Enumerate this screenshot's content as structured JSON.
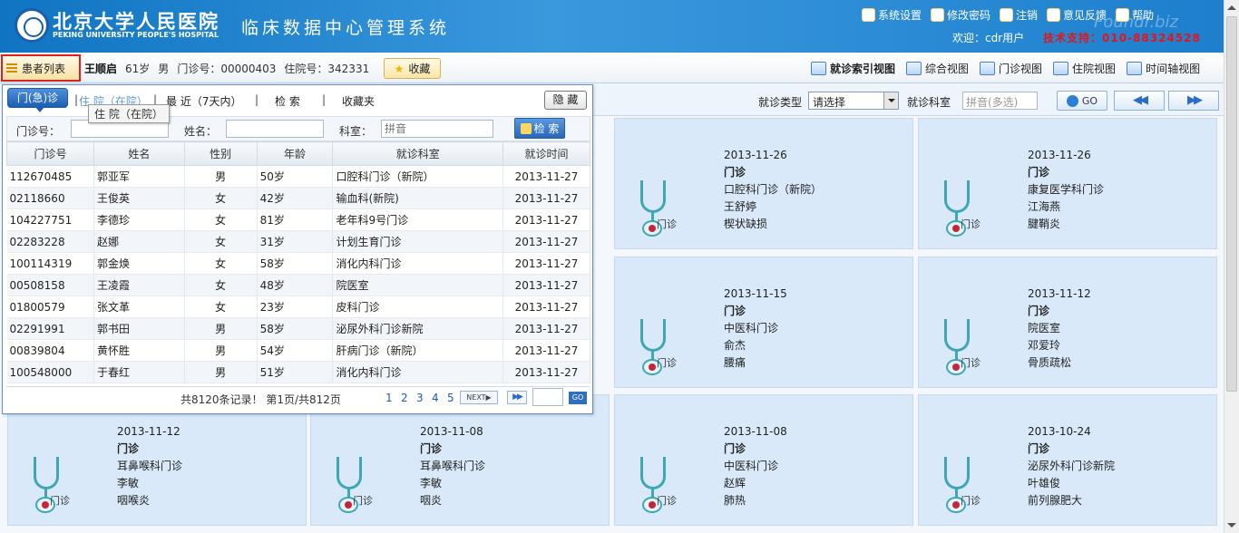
{
  "header": {
    "hospital_cn": "北京大学人民医院",
    "hospital_en": "PEKING UNIVERSITY PEOPLE'S HOSPITAL",
    "system_title": "临床数据中心管理系统",
    "watermark": "Foundr.biz",
    "nav": [
      {
        "label": "系统设置",
        "icon": "gear-icon"
      },
      {
        "label": "修改密码",
        "icon": "pencil-icon"
      },
      {
        "label": "注销",
        "icon": "clock-icon"
      },
      {
        "label": "意见反馈",
        "icon": "feedback-icon"
      },
      {
        "label": "帮助",
        "icon": "help-icon"
      }
    ],
    "welcome": "欢迎：cdr用户",
    "support": "技术支持：010-88324528"
  },
  "patient_bar": {
    "list_button": "患者列表",
    "name": "王顺启",
    "age": "61岁",
    "gender": "男",
    "outpatient_no": "门诊号：00000403",
    "inpatient_no": "住院号：342331",
    "favorite_button": "收藏",
    "views": [
      {
        "label": "就诊索引视图",
        "active": true
      },
      {
        "label": "综合视图",
        "active": false
      },
      {
        "label": "门诊视图",
        "active": false
      },
      {
        "label": "住院视图",
        "active": false
      },
      {
        "label": "时间轴视图",
        "active": false
      }
    ]
  },
  "filter": {
    "visit_type_label": "就诊类型",
    "visit_type_value": "请选择",
    "dept_label": "就诊科室",
    "dept_placeholder": "拼音(多选)",
    "go_label": "GO",
    "prev_label": "◀◀",
    "next_label": "▶▶"
  },
  "cards": [
    {
      "date": "2013-11-26",
      "type": "门诊",
      "dept": "口腔科门诊（新院）",
      "doctor": "王舒婷",
      "diagnosis": "楔状缺损"
    },
    {
      "date": "2013-11-26",
      "type": "门诊",
      "dept": "康复医学科门诊",
      "doctor": "江海燕",
      "diagnosis": "腱鞘炎"
    },
    {
      "date": "2013-11-15",
      "type": "门诊",
      "dept": "中医科门诊",
      "doctor": "俞杰",
      "diagnosis": "腰痛"
    },
    {
      "date": "2013-11-12",
      "type": "门诊",
      "dept": "院医室",
      "doctor": "邓爱玲",
      "diagnosis": "骨质疏松"
    },
    {
      "date": "2013-11-12",
      "type": "门诊",
      "dept": "耳鼻喉科门诊",
      "doctor": "李敏",
      "diagnosis": "咽喉炎"
    },
    {
      "date": "2013-11-08",
      "type": "门诊",
      "dept": "耳鼻喉科门诊",
      "doctor": "李敏",
      "diagnosis": "咽炎"
    },
    {
      "date": "2013-11-08",
      "type": "门诊",
      "dept": "中医科门诊",
      "doctor": "赵辉",
      "diagnosis": "肺热"
    },
    {
      "date": "2013-10-24",
      "type": "门诊",
      "dept": "泌尿外科门诊新院",
      "doctor": "叶雄俊",
      "diagnosis": "前列腺肥大"
    }
  ],
  "card_icon_label": "门诊",
  "popup": {
    "tabs": {
      "outpatient": "门(急)诊",
      "inpatient": "住 院（在院）",
      "recent": "最 近（7天内）",
      "search": "检 索",
      "favorites": "收藏夹",
      "separator": "|"
    },
    "hide_button": "隐 藏",
    "tooltip": "住 院（在院）",
    "search": {
      "outpatient_label": "门诊号：",
      "outpatient_value": "",
      "name_label": "姓名：",
      "name_value": "",
      "dept_label": "科室：",
      "dept_placeholder": "拼音",
      "button": "检 索"
    },
    "columns": [
      "门诊号",
      "姓名",
      "性别",
      "年龄",
      "就诊科室",
      "就诊时间"
    ],
    "rows": [
      [
        "112670485",
        "郭亚军",
        "男",
        "50岁",
        "口腔科门诊（新院）",
        "2013-11-27"
      ],
      [
        "02118660",
        "王俊英",
        "女",
        "42岁",
        "输血科(新院)",
        "2013-11-27"
      ],
      [
        "104227751",
        "李德珍",
        "女",
        "81岁",
        "老年科9号门诊",
        "2013-11-27"
      ],
      [
        "02283228",
        "赵娜",
        "女",
        "31岁",
        "计划生育门诊",
        "2013-11-27"
      ],
      [
        "100114319",
        "郭金焕",
        "女",
        "58岁",
        "消化内科门诊",
        "2013-11-27"
      ],
      [
        "00508158",
        "王凌霞",
        "女",
        "48岁",
        "院医室",
        "2013-11-27"
      ],
      [
        "01800579",
        "张文革",
        "女",
        "23岁",
        "皮科门诊",
        "2013-11-27"
      ],
      [
        "02291991",
        "郭书田",
        "男",
        "58岁",
        "泌尿外科门诊新院",
        "2013-11-27"
      ],
      [
        "00839804",
        "黄怀胜",
        "男",
        "54岁",
        "肝病门诊（新院）",
        "2013-11-27"
      ],
      [
        "100548000",
        "于春红",
        "男",
        "51岁",
        "消化内科门诊",
        "2013-11-27"
      ]
    ],
    "pager": {
      "info": "共8120条记录！ 第1页/共812页",
      "pages": [
        "1",
        "2",
        "3",
        "4",
        "5"
      ],
      "next_label": "NEXT▶",
      "last_label": "▶▶",
      "go_label": "GO"
    }
  }
}
